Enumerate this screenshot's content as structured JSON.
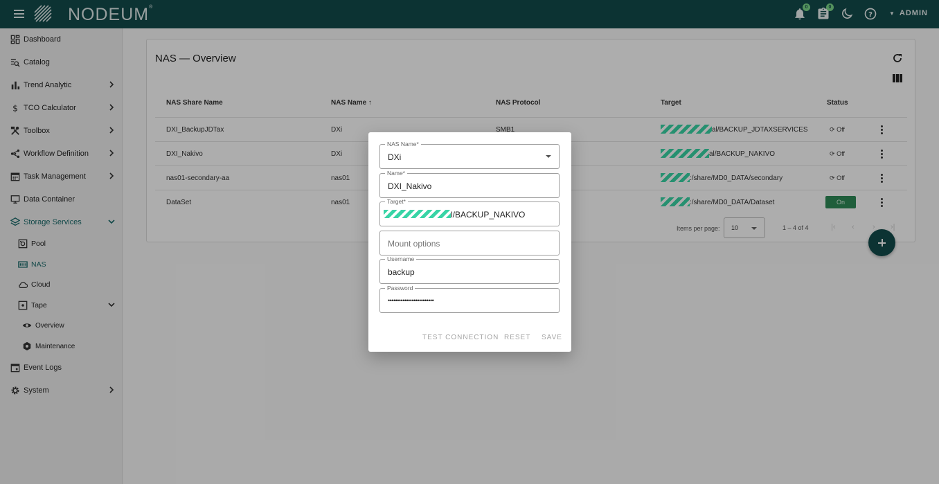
{
  "app": {
    "logo_text": "NODEUM",
    "logo_reg": "®"
  },
  "topbar": {
    "notifications_badge": "0",
    "tasks_badge": "0",
    "user_label": "ADMIN"
  },
  "sidebar": {
    "items": [
      {
        "label": "Dashboard",
        "icon": "dashboard-icon"
      },
      {
        "label": "Catalog",
        "icon": "catalog-search-icon"
      },
      {
        "label": "Trend Analytic",
        "icon": "bar-chart-icon"
      },
      {
        "label": "TCO Calculator",
        "icon": "dollar-icon"
      },
      {
        "label": "Toolbox",
        "icon": "tools-icon"
      },
      {
        "label": "Workflow Definition",
        "icon": "workflow-icon"
      },
      {
        "label": "Task Management",
        "icon": "calendar-icon"
      },
      {
        "label": "Data Container",
        "icon": "monitor-icon"
      },
      {
        "label": "Storage Services",
        "icon": "layers-icon"
      },
      {
        "label": "Pool",
        "icon": "pool-icon"
      },
      {
        "label": "NAS",
        "icon": "nas-icon"
      },
      {
        "label": "Cloud",
        "icon": "cloud-icon"
      },
      {
        "label": "Tape",
        "icon": "tape-icon"
      },
      {
        "label": "Overview",
        "icon": "eye-icon"
      },
      {
        "label": "Maintenance",
        "icon": "hexagon-icon"
      },
      {
        "label": "Event Logs",
        "icon": "event-calendar-icon"
      },
      {
        "label": "System",
        "icon": "gear-icon"
      }
    ]
  },
  "main": {
    "title": "NAS — Overview",
    "columns": [
      "NAS Share Name",
      "NAS Name",
      "NAS Protocol",
      "Target",
      "Status"
    ],
    "rows": [
      {
        "share": "DXI_BackupJDTax",
        "nas": "DXi",
        "protocol": "SMB1",
        "target": "al/BACKUP_JDTAXSERVICES",
        "status": "Off"
      },
      {
        "share": "DXI_Nakivo",
        "nas": "DXi",
        "protocol": "",
        "target": "al/BACKUP_NAKIVO",
        "status": "Off"
      },
      {
        "share": "nas01-secondary-aa",
        "nas": "nas01",
        "protocol": "",
        "target": ":/share/MD0_DATA/secondary",
        "status": "Off"
      },
      {
        "share": "DataSet",
        "nas": "nas01",
        "protocol": "",
        "target": ":/share/MD0_DATA/Dataset",
        "status": "On"
      }
    ],
    "items_per_page_label": "Items per page:",
    "items_per_page": "10",
    "range_label": "1 – 4 of 4"
  },
  "dialog": {
    "nas_name": {
      "label": "NAS Name*",
      "value": "DXi"
    },
    "name": {
      "label": "Name*",
      "value": "DXI_Nakivo"
    },
    "target": {
      "label": "Target*",
      "value": "l/BACKUP_NAKIVO"
    },
    "mount_options": {
      "placeholder": "Mount options"
    },
    "username": {
      "label": "Username",
      "value": "backup"
    },
    "password": {
      "label": "Password",
      "value": "•••••••••••••••••••••••••"
    },
    "buttons": {
      "test": "TEST CONNECTION",
      "reset": "RESET",
      "save": "SAVE"
    }
  },
  "colors": {
    "brand": "#124c4c",
    "accent": "#38d4a6",
    "status_on": "#2e8b57"
  }
}
